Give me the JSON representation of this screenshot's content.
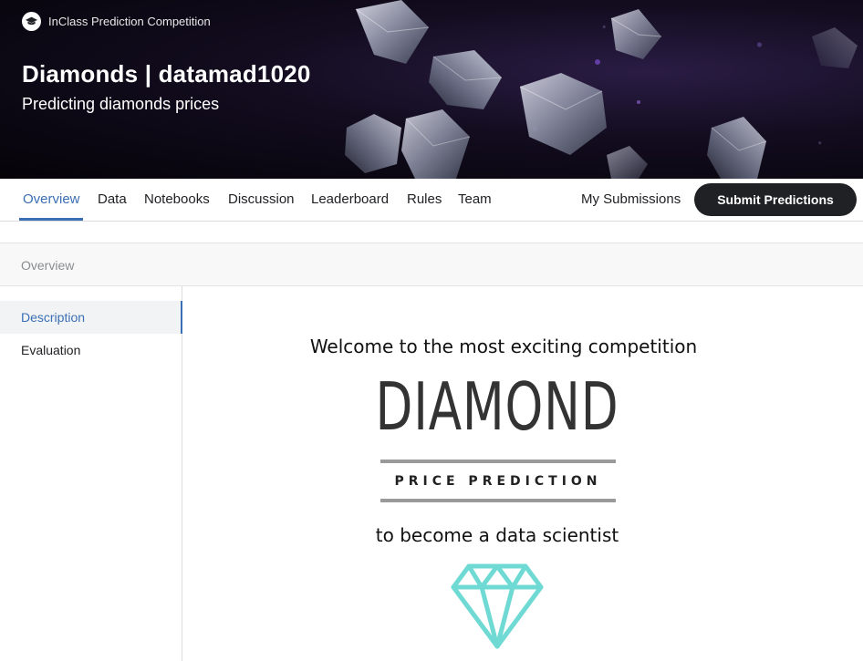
{
  "header": {
    "competition_type": "InClass Prediction Competition",
    "title": "Diamonds | datamad1020",
    "subtitle": "Predicting diamonds prices"
  },
  "tabs": [
    {
      "label": "Overview",
      "active": true
    },
    {
      "label": "Data"
    },
    {
      "label": "Notebooks"
    },
    {
      "label": "Discussion"
    },
    {
      "label": "Leaderboard"
    },
    {
      "label": "Rules"
    },
    {
      "label": "Team"
    }
  ],
  "actions": {
    "my_submissions": "My Submissions",
    "submit_predictions": "Submit Predictions"
  },
  "section_title": "Overview",
  "sidebar": {
    "items": [
      {
        "label": "Description",
        "active": true
      },
      {
        "label": "Evaluation"
      }
    ]
  },
  "content": {
    "welcome": "Welcome to the most exciting competition",
    "diamond": "DIAMOND",
    "price_prediction": "PRICE PREDICTION",
    "become": "to become a data scientist"
  },
  "colors": {
    "accent": "#3b6fb5",
    "button": "#202124",
    "gem_icon": "#6fd9d4"
  },
  "icons": {
    "competition_type": "graduation-cap-icon",
    "content_graphic": "diamond-icon"
  }
}
